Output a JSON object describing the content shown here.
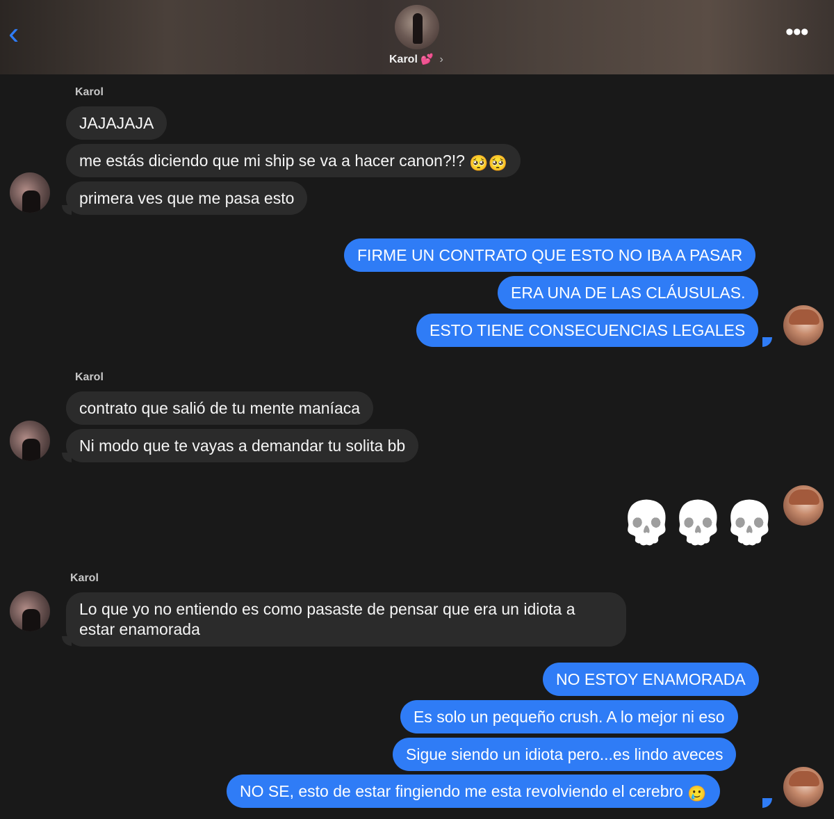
{
  "header": {
    "back_icon": "chevron-left-icon",
    "contact_name": "Karol",
    "heart_emoji": "💕",
    "chevron": "›",
    "more_icon": "•••"
  },
  "messages": [
    {
      "sender": "Karol"
    },
    {
      "text": "JAJAJAJA"
    },
    {
      "text": "me estás diciendo que mi ship se va a hacer canon?!?",
      "emoji": "🥺🥺"
    },
    {
      "text": "primera ves que me pasa esto"
    },
    {
      "text": "FIRME UN CONTRATO QUE ESTO NO IBA A PASAR"
    },
    {
      "text": "ERA UNA DE LAS CLÁUSULAS."
    },
    {
      "text": "ESTO TIENE CONSECUENCIAS LEGALES"
    },
    {
      "sender": "Karol"
    },
    {
      "text": "contrato que salió de tu mente maníaca"
    },
    {
      "text": "Ni modo que te vayas a demandar tu solita bb"
    },
    {
      "skulls": [
        "💀",
        "💀",
        "💀"
      ]
    },
    {
      "sender": "Karol"
    },
    {
      "text": "Lo que yo no entiendo es como pasaste de pensar que era un idiota a estar enamorada"
    },
    {
      "text": "NO ESTOY ENAMORADA"
    },
    {
      "text": "Es solo un pequeño crush. A lo mejor ni eso"
    },
    {
      "text": "Sigue siendo un idiota pero...es lindo aveces"
    },
    {
      "text": "NO SE, esto de estar fingiendo me esta revolviendo el cerebro",
      "emoji": "🥲"
    }
  ]
}
